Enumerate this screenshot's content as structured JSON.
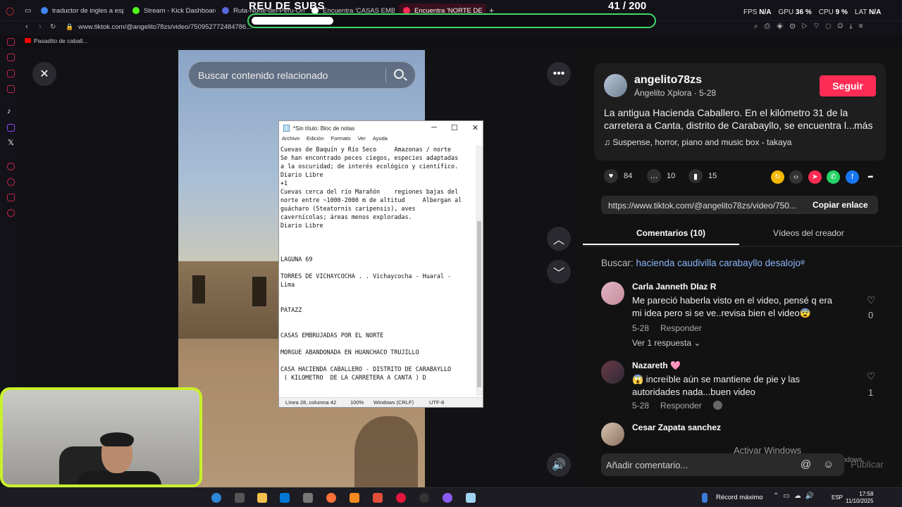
{
  "browser": {
    "tabs": [
      {
        "label": "traductor de ingles a espa",
        "color": "#4285f4"
      },
      {
        "label": "Stream - Kick Dashboard",
        "color": "#53fc18"
      },
      {
        "label": "Ruta-Norte-del-Peru-On...",
        "color": "#5a67d8"
      },
      {
        "label": "Encuentra 'CASAS EMBR",
        "color": "#ffffff"
      },
      {
        "label": "Encuentra 'NORTE DE",
        "color": "#fe2c55"
      }
    ],
    "url": "www.tiktok.com/@angelito78zs/video/750952772484786...",
    "bookmark": "Pasadito de caball...",
    "stats": {
      "fps_label": "FPS",
      "fps": "N/A",
      "gpu_label": "GPU",
      "gpu": "36 %",
      "cpu_label": "CPU",
      "cpu": "9 %",
      "lat_label": "LAT",
      "lat": "N/A"
    }
  },
  "overlay": {
    "title": "REU DE SUBS",
    "count": "41  / 200",
    "progress": 0.205
  },
  "video": {
    "search_placeholder": "Buscar contenido relacionado"
  },
  "notepad": {
    "title": "*Sin título: Bloc de notas",
    "menu": [
      "Archivo",
      "Edición",
      "Formato",
      "Ver",
      "Ayuda"
    ],
    "content": "Cuevas de Baquín y Río Seco     Amazonas / norte\nSe han encontrado peces ciegos, especies adaptadas\na la oscuridad; de interés ecológico y científico.\nDiario Libre\n+1\nCuevas cerca del río Marañón    regiones bajas del\nnorte entre ~1000-2000 m de altitud     Albergan al\nguácharo (Steatornis caripensis), aves\ncavernícolas; áreas menos exploradas.\nDiario Libre\n\n\n\nLAGUNA 69\n\nTORRES DE VICHAYCOCHA . . Vichaycocha - Huaral -\nLima\n\n\nPATAZZ\n\n\nCASAS EMBRUJADAS POR EL NORTE\n\nMORGUE ABANDONADA EN HUANCHACO TRUJILLO\n\nCASA HACIENDA CABALLERO - DISTRITO DE CARABAYLLO\n ( KILOMETRO  DE LA CARRETERA A CANTA ) D",
    "status": {
      "position": "Línea 28, columna 42",
      "zoom": "100%",
      "eol": "Windows (CRLF)",
      "encoding": "UTF-8"
    }
  },
  "post": {
    "username": "angelito78zs",
    "userline": "Ángelito Xplora · 5-28",
    "follow": "Seguir",
    "description": "La antigua Hacienda Caballero. En el kilómetro 31 de la carretera a Canta, distrito de Carabayllo, se encuentra l...",
    "more": "más",
    "music": "♫  Suspense, horror, piano and music box - takaya",
    "likes": "84",
    "comments": "10",
    "saves": "15",
    "link": "https://www.tiktok.com/@angelito78zs/video/750...",
    "copy_link": "Copiar enlace"
  },
  "tabs": {
    "comments": "Comentarios (10)",
    "videos": "Vídeos del creador"
  },
  "search": {
    "label": "Buscar:",
    "query": "hacienda caudivilla carabayllo desalojo"
  },
  "comments": [
    {
      "name": "Carla Janneth DIaz R",
      "text": "Me pareció haberla visto en el video, pensé q era mi idea pero si se ve..revisa bien el video😨",
      "date": "5-28",
      "reply": "Responder",
      "likes": "0"
    },
    {
      "name": "Nazareth 🩷",
      "text": "😱 increíble aún se mantiene de pie y las autoridades nada...buen video",
      "date": "5-28",
      "reply": "Responder",
      "likes": "1"
    },
    {
      "name": "Cesar Zapata sanchez",
      "text": "",
      "date": "",
      "reply": "",
      "likes": ""
    }
  ],
  "replies_toggle": "Ver 1 respuesta",
  "comment_input": "Añadir comentario...",
  "publish": "Publicar",
  "windows": {
    "line1": "Activar Windows",
    "line2": "Ve a Configuración para activar Windows."
  },
  "taskbar": {
    "record": "Récord máximo",
    "lang": "ESP",
    "time": "17:58",
    "date": "11/10/2025"
  }
}
